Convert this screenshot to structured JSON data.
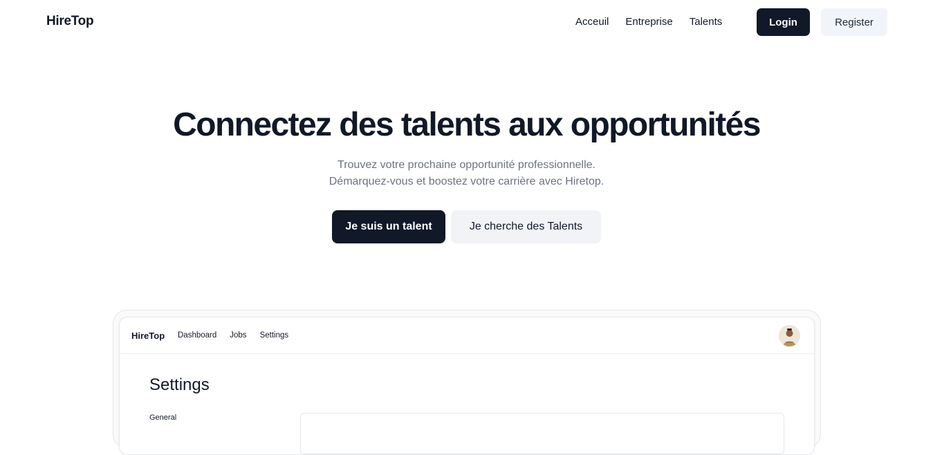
{
  "header": {
    "brand": "HireTop",
    "nav": [
      "Acceuil",
      "Entreprise",
      "Talents"
    ],
    "login_label": "Login",
    "register_label": "Register"
  },
  "hero": {
    "title": "Connectez des talents aux opportunités",
    "subtitle_line1": "Trouvez votre prochaine opportunité professionnelle.",
    "subtitle_line2": "Démarquez-vous et boostez votre carrière avec Hiretop.",
    "cta_primary": "Je suis un talent",
    "cta_secondary": "Je cherche des Talents"
  },
  "preview": {
    "brand": "HireTop",
    "nav": [
      "Dashboard",
      "Jobs",
      "Settings"
    ],
    "page_title": "Settings",
    "section_label": "General",
    "avatar_icon": "user-avatar"
  },
  "colors": {
    "primary": "#111827",
    "secondary_bg": "#f1f4f9",
    "muted_text": "#6b7280"
  }
}
